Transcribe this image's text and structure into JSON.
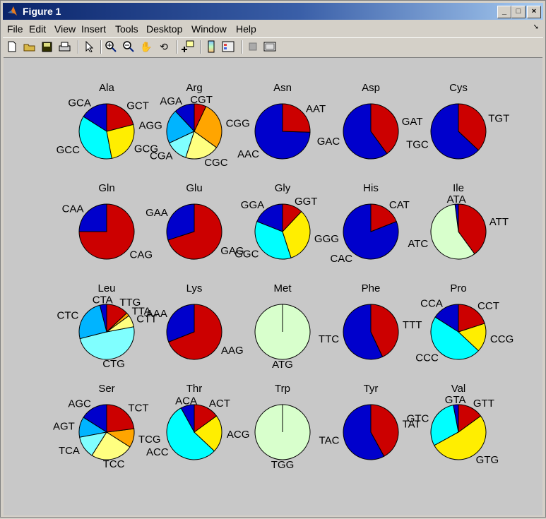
{
  "window": {
    "title": "Figure 1",
    "minimize": "_",
    "maximize": "□",
    "close": "×"
  },
  "menu": [
    "File",
    "Edit",
    "View",
    "Insert",
    "Tools",
    "Desktop",
    "Window",
    "Help"
  ],
  "toolbar_icons": [
    "new-file-icon",
    "open-folder-icon",
    "save-icon",
    "print-icon",
    "select-arrow-icon",
    "zoom-in-icon",
    "zoom-out-icon",
    "pan-hand-icon",
    "rotate-3d-icon",
    "data-cursor-icon",
    "colorbar-icon",
    "legend-icon",
    "hide-plot-tools-icon",
    "show-plot-tools-icon"
  ],
  "colors": {
    "blue": "#0000cc",
    "deepsky": "#00b4ff",
    "lightcyan": "#80ffff",
    "cyan": "#00ffff",
    "lightyellow": "#ffff80",
    "yellow": "#ffee00",
    "orange": "#ffa500",
    "red": "#cc0000",
    "palegreen": "#d8ffcc"
  },
  "chart_data": {
    "type": "pie",
    "grid": [
      4,
      5
    ],
    "charts": [
      {
        "title": "Ala",
        "labels": [
          "GCA",
          "GCC",
          "GCG",
          "GCT"
        ],
        "values": [
          0.16,
          0.37,
          0.26,
          0.21
        ]
      },
      {
        "title": "Arg",
        "labels": [
          "AGA",
          "AGG",
          "CGA",
          "CGC",
          "CGG",
          "CGT"
        ],
        "values": [
          0.12,
          0.2,
          0.13,
          0.2,
          0.28,
          0.07
        ]
      },
      {
        "title": "Asn",
        "labels": [
          "AAC",
          "AAT"
        ],
        "values": [
          0.745,
          0.255
        ]
      },
      {
        "title": "Asp",
        "labels": [
          "GAC",
          "GAT"
        ],
        "values": [
          0.6,
          0.4
        ]
      },
      {
        "title": "Cys",
        "labels": [
          "TGC",
          "TGT"
        ],
        "values": [
          0.63,
          0.37
        ]
      },
      {
        "title": "Gln",
        "labels": [
          "CAA",
          "CAG"
        ],
        "values": [
          0.25,
          0.75
        ]
      },
      {
        "title": "Glu",
        "labels": [
          "GAA",
          "GAG"
        ],
        "values": [
          0.3,
          0.7
        ]
      },
      {
        "title": "Gly",
        "labels": [
          "GGA",
          "GGC",
          "GGG",
          "GGT"
        ],
        "values": [
          0.19,
          0.36,
          0.33,
          0.12
        ]
      },
      {
        "title": "His",
        "labels": [
          "CAC",
          "CAT"
        ],
        "values": [
          0.81,
          0.19
        ]
      },
      {
        "title": "Ile",
        "labels": [
          "ATA",
          "ATC",
          "ATT"
        ],
        "values": [
          0.02,
          0.58,
          0.4
        ]
      },
      {
        "title": "Leu",
        "labels": [
          "CTA",
          "CTC",
          "CTG",
          "CTT",
          "TTA",
          "TTG"
        ],
        "values": [
          0.04,
          0.25,
          0.49,
          0.07,
          0.02,
          0.13
        ]
      },
      {
        "title": "Lys",
        "labels": [
          "AAA",
          "AAG"
        ],
        "values": [
          0.31,
          0.69
        ]
      },
      {
        "title": "Met",
        "labels": [
          "ATG"
        ],
        "values": [
          1.0
        ]
      },
      {
        "title": "Phe",
        "labels": [
          "TTC",
          "TTT"
        ],
        "values": [
          0.57,
          0.43
        ]
      },
      {
        "title": "Pro",
        "labels": [
          "CCA",
          "CCC",
          "CCG",
          "CCT"
        ],
        "values": [
          0.16,
          0.47,
          0.17,
          0.2
        ]
      },
      {
        "title": "Ser",
        "labels": [
          "AGC",
          "AGT",
          "TCA",
          "TCC",
          "TCG",
          "TCT"
        ],
        "values": [
          0.16,
          0.12,
          0.13,
          0.25,
          0.11,
          0.23
        ]
      },
      {
        "title": "Thr",
        "labels": [
          "ACA",
          "ACC",
          "ACG",
          "ACT"
        ],
        "values": [
          0.08,
          0.55,
          0.22,
          0.15
        ]
      },
      {
        "title": "Trp",
        "labels": [
          "TGG"
        ],
        "values": [
          1.0
        ]
      },
      {
        "title": "Tyr",
        "labels": [
          "TAC",
          "TAT"
        ],
        "values": [
          0.58,
          0.42
        ]
      },
      {
        "title": "Val",
        "labels": [
          "GTA",
          "GTC",
          "GTG",
          "GTT"
        ],
        "values": [
          0.03,
          0.3,
          0.52,
          0.15
        ]
      }
    ]
  }
}
